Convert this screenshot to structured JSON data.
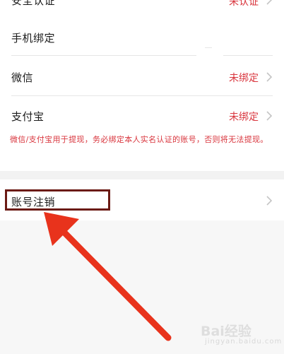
{
  "rows": {
    "top_cut": {
      "label": "安全认证",
      "value": "未认证"
    },
    "phone": {
      "label": "手机绑定"
    },
    "wechat": {
      "label": "微信",
      "value": "未绑定"
    },
    "alipay": {
      "label": "支付宝",
      "value": "未绑定"
    }
  },
  "warning_text": "微信/支付宝用于提现，务必绑定本人实名认证的账号，否则将无法提现。",
  "cancel_account": {
    "label": "账号注销"
  },
  "watermark": {
    "main": "Bai经验",
    "sub": "jingyan.baidu.com"
  },
  "icons": {
    "chevron": "chevron-right-icon",
    "arrow": "red-annotation-arrow-icon"
  },
  "colors": {
    "accent": "#d9363e",
    "annotation": "#e8331c",
    "highlight_border": "#6b1a14"
  }
}
